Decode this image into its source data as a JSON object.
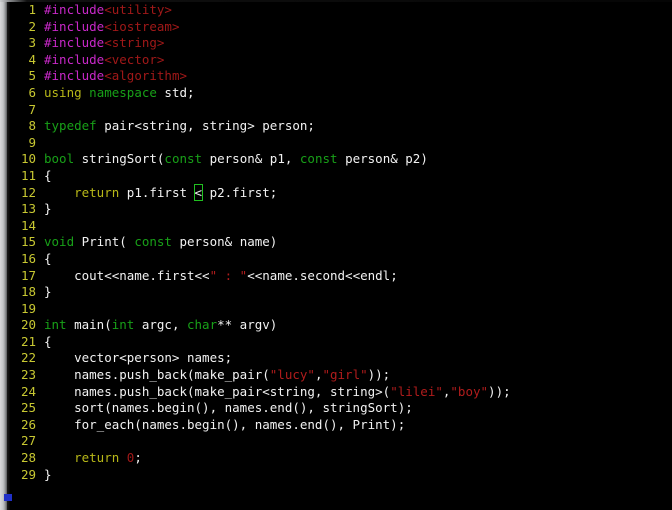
{
  "editor": {
    "language": "C++",
    "total_lines": 29,
    "first_visible_line": 1,
    "colors": {
      "background": "#000000",
      "line_number": "#c8c832",
      "plain_text": "#f2f2f2",
      "preprocessor": "#c828c8",
      "header_name": "#a01818",
      "keyword": "#18a018",
      "control_keyword": "#b8b818",
      "string_literal": "#b01c1c",
      "number_literal": "#a01818",
      "bracket_match_outline": "#20c020",
      "gutter_marker": "#2030c8"
    },
    "bracket_match": {
      "line": 12,
      "character": "<"
    },
    "gutter_marker": {
      "label": "caret-marker",
      "line": 30
    }
  },
  "lines": [
    {
      "n": "1",
      "tokens": [
        {
          "t": "#include",
          "c": "pre"
        },
        {
          "t": "<utility>",
          "c": "header"
        }
      ]
    },
    {
      "n": "2",
      "tokens": [
        {
          "t": "#include",
          "c": "pre"
        },
        {
          "t": "<iostream>",
          "c": "header"
        }
      ]
    },
    {
      "n": "3",
      "tokens": [
        {
          "t": "#include",
          "c": "pre"
        },
        {
          "t": "<string>",
          "c": "header"
        }
      ]
    },
    {
      "n": "4",
      "tokens": [
        {
          "t": "#include",
          "c": "pre"
        },
        {
          "t": "<vector>",
          "c": "header"
        }
      ]
    },
    {
      "n": "5",
      "tokens": [
        {
          "t": "#include",
          "c": "pre"
        },
        {
          "t": "<algorithm>",
          "c": "header"
        }
      ]
    },
    {
      "n": "6",
      "tokens": [
        {
          "t": "using",
          "c": "ctrl"
        },
        {
          "t": " ",
          "c": "plain"
        },
        {
          "t": "namespace",
          "c": "kw"
        },
        {
          "t": " std;",
          "c": "plain"
        }
      ]
    },
    {
      "n": "7",
      "tokens": []
    },
    {
      "n": "8",
      "tokens": [
        {
          "t": "typedef",
          "c": "kw"
        },
        {
          "t": " pair<string, string> person;",
          "c": "plain"
        }
      ]
    },
    {
      "n": "9",
      "tokens": []
    },
    {
      "n": "10",
      "tokens": [
        {
          "t": "bool",
          "c": "kw"
        },
        {
          "t": " stringSort(",
          "c": "plain"
        },
        {
          "t": "const",
          "c": "kw"
        },
        {
          "t": " person& p1, ",
          "c": "plain"
        },
        {
          "t": "const",
          "c": "kw"
        },
        {
          "t": " person& p2)",
          "c": "plain"
        }
      ]
    },
    {
      "n": "11",
      "tokens": [
        {
          "t": "{",
          "c": "plain"
        }
      ]
    },
    {
      "n": "12",
      "tokens": [
        {
          "t": "    ",
          "c": "plain"
        },
        {
          "t": "return",
          "c": "ctrl"
        },
        {
          "t": " p1.first ",
          "c": "plain"
        },
        {
          "t": "<",
          "c": "match"
        },
        {
          "t": " p2.first;",
          "c": "plain"
        }
      ]
    },
    {
      "n": "13",
      "tokens": [
        {
          "t": "}",
          "c": "plain"
        }
      ]
    },
    {
      "n": "14",
      "tokens": []
    },
    {
      "n": "15",
      "tokens": [
        {
          "t": "void",
          "c": "kw"
        },
        {
          "t": " Print( ",
          "c": "plain"
        },
        {
          "t": "const",
          "c": "kw"
        },
        {
          "t": " person& name)",
          "c": "plain"
        }
      ]
    },
    {
      "n": "16",
      "tokens": [
        {
          "t": "{",
          "c": "plain"
        }
      ]
    },
    {
      "n": "17",
      "tokens": [
        {
          "t": "    cout<<name.first<<",
          "c": "plain"
        },
        {
          "t": "\" : \"",
          "c": "str"
        },
        {
          "t": "<<name.second<<endl;",
          "c": "plain"
        }
      ]
    },
    {
      "n": "18",
      "tokens": [
        {
          "t": "}",
          "c": "plain"
        }
      ]
    },
    {
      "n": "19",
      "tokens": []
    },
    {
      "n": "20",
      "tokens": [
        {
          "t": "int",
          "c": "kw"
        },
        {
          "t": " main(",
          "c": "plain"
        },
        {
          "t": "int",
          "c": "kw"
        },
        {
          "t": " argc, ",
          "c": "plain"
        },
        {
          "t": "char",
          "c": "kw"
        },
        {
          "t": "** argv)",
          "c": "plain"
        }
      ]
    },
    {
      "n": "21",
      "tokens": [
        {
          "t": "{",
          "c": "plain"
        }
      ]
    },
    {
      "n": "22",
      "tokens": [
        {
          "t": "    vector<person> names;",
          "c": "plain"
        }
      ]
    },
    {
      "n": "23",
      "tokens": [
        {
          "t": "    names.push_back(make_pair(",
          "c": "plain"
        },
        {
          "t": "\"lucy\"",
          "c": "str"
        },
        {
          "t": ",",
          "c": "plain"
        },
        {
          "t": "\"girl\"",
          "c": "str"
        },
        {
          "t": "));",
          "c": "plain"
        }
      ]
    },
    {
      "n": "24",
      "tokens": [
        {
          "t": "    names.push_back(make_pair<string, string>(",
          "c": "plain"
        },
        {
          "t": "\"lilei\"",
          "c": "str"
        },
        {
          "t": ",",
          "c": "plain"
        },
        {
          "t": "\"boy\"",
          "c": "str"
        },
        {
          "t": "));",
          "c": "plain"
        }
      ]
    },
    {
      "n": "25",
      "tokens": [
        {
          "t": "    sort(names.begin(), names.end(), stringSort);",
          "c": "plain"
        }
      ]
    },
    {
      "n": "26",
      "tokens": [
        {
          "t": "    for_each(names.begin(), names.end(), Print);",
          "c": "plain"
        }
      ]
    },
    {
      "n": "27",
      "tokens": []
    },
    {
      "n": "28",
      "tokens": [
        {
          "t": "    ",
          "c": "plain"
        },
        {
          "t": "return",
          "c": "ctrl"
        },
        {
          "t": " ",
          "c": "plain"
        },
        {
          "t": "0",
          "c": "num"
        },
        {
          "t": ";",
          "c": "plain"
        }
      ]
    },
    {
      "n": "29",
      "tokens": [
        {
          "t": "}",
          "c": "plain"
        }
      ]
    }
  ]
}
